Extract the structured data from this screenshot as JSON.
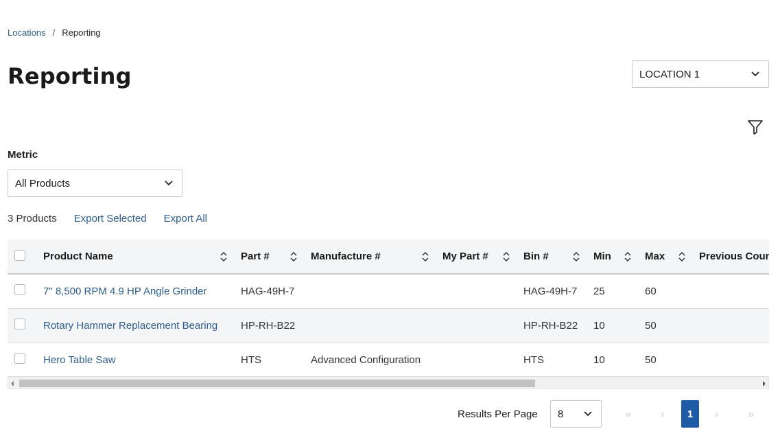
{
  "breadcrumb": {
    "parent": "Locations",
    "separator": "/",
    "current": "Reporting"
  },
  "page": {
    "title": "Reporting"
  },
  "location_select": {
    "value": "LOCATION 1",
    "icon": "chevron-down-icon"
  },
  "filter": {
    "icon": "filter-icon"
  },
  "metric": {
    "label": "Metric",
    "value": "All Products"
  },
  "toolbar": {
    "count": "3 Products",
    "export_selected": "Export Selected",
    "export_all": "Export All"
  },
  "table": {
    "columns": [
      "Product Name",
      "Part #",
      "Manufacture #",
      "My Part #",
      "Bin #",
      "Min",
      "Max",
      "Previous Count"
    ],
    "rows": [
      {
        "name": "7\" 8,500 RPM 4.9 HP Angle Grinder",
        "part": "HAG-49H-7",
        "manufacture": "",
        "my_part": "",
        "bin": "HAG-49H-7",
        "min": "25",
        "max": "60",
        "previous": ""
      },
      {
        "name": "Rotary Hammer Replacement Bearing",
        "part": "HP-RH-B22",
        "manufacture": "",
        "my_part": "",
        "bin": "HP-RH-B22",
        "min": "10",
        "max": "50",
        "previous": ""
      },
      {
        "name": "Hero Table Saw",
        "part": "HTS",
        "manufacture": "Advanced Configuration",
        "my_part": "",
        "bin": "HTS",
        "min": "10",
        "max": "50",
        "previous": ""
      }
    ]
  },
  "pagination": {
    "results_per_page_label": "Results Per Page",
    "results_per_page": "8",
    "first": "«",
    "prev": "‹",
    "current_page": "1",
    "next": "›",
    "last": "»"
  },
  "colors": {
    "link": "#2c5d8f",
    "accent": "#1f5aa6",
    "header_bg": "#f4f5f6"
  }
}
